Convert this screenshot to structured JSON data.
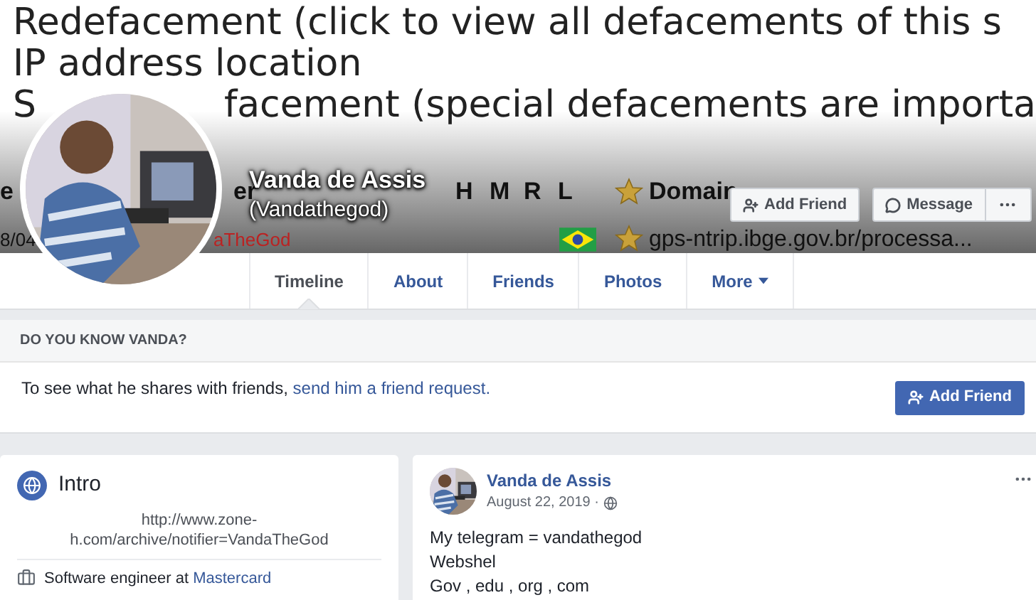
{
  "cover": {
    "lines": [
      "Redefacement (click to view all defacements of this s",
      "IP address location"
    ],
    "line_3": [
      "S",
      "facement (special defacements are importa"
    ],
    "header": [
      "e",
      "er",
      "H",
      "M",
      "R",
      "L",
      "Domain"
    ],
    "row": [
      "8/04",
      "aTheGod",
      "gps-ntrip.ibge.gov.br/processa..."
    ]
  },
  "profile": {
    "name": "Vanda de Assis",
    "handle": "(Vandathegod)",
    "buttons": [
      "Add Friend",
      "Message"
    ]
  },
  "tabs": [
    {
      "label": "Timeline",
      "selected": true,
      "has_menu": false
    },
    {
      "label": "About",
      "selected": false,
      "has_menu": false
    },
    {
      "label": "Friends",
      "selected": false,
      "has_menu": false
    },
    {
      "label": "Photos",
      "selected": false,
      "has_menu": false
    },
    {
      "label": "More",
      "selected": false,
      "has_menu": true
    }
  ],
  "know_card": {
    "title": "DO YOU KNOW VANDA?",
    "text": "To see what he shares with friends,",
    "link": "send him a friend request.",
    "button": "Add Friend"
  },
  "intro": {
    "title": "Intro",
    "link": "http://www.zone-h.com/archive/notifier=VandaTheGod",
    "work_text": "Software engineer at",
    "work_link": "Mastercard"
  },
  "post": {
    "author": "Vanda de Assis",
    "date": "August 22, 2019 ·",
    "lines": [
      "My telegram = vandathegod",
      "Webshel",
      "Gov , edu , org , com"
    ]
  }
}
